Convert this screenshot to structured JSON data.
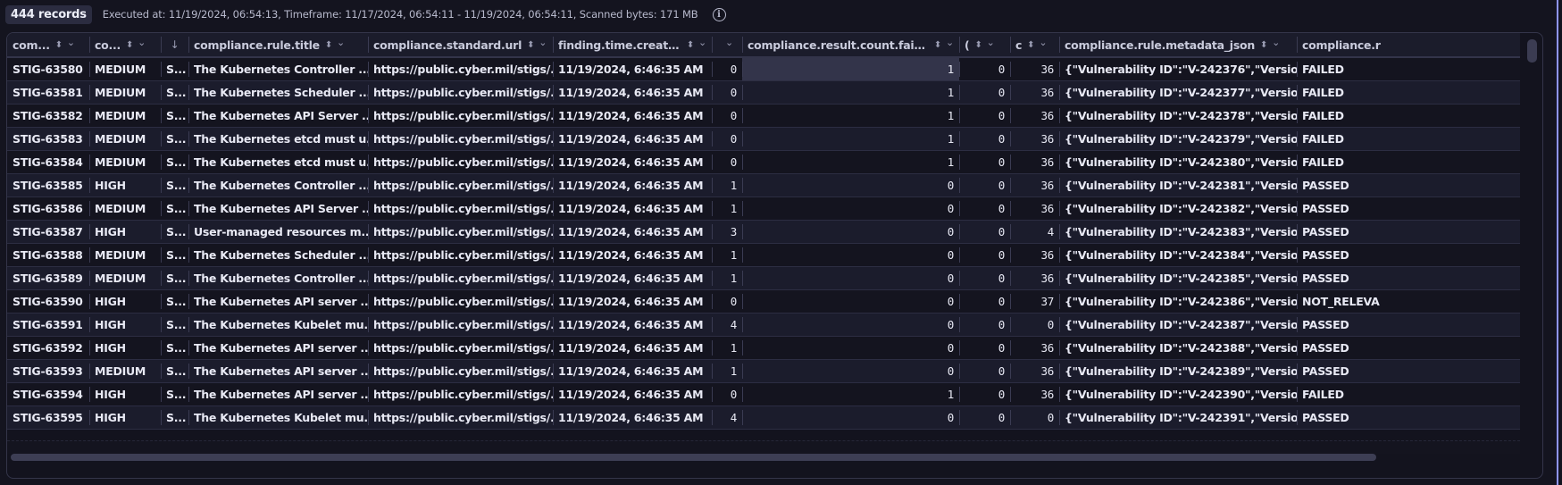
{
  "toolbar": {
    "record_count": "444 records",
    "execution_info": "Executed at: 11/19/2024, 06:54:13, Timeframe: 11/17/2024, 06:54:11 - 11/19/2024, 06:54:11, Scanned bytes: 171 MB",
    "info_icon": "info-icon"
  },
  "table": {
    "columns": [
      {
        "label": "com...",
        "sortable": true,
        "menu": true
      },
      {
        "label": "co...",
        "sortable": true,
        "menu": true
      },
      {
        "label": "",
        "sort_direction": "descending",
        "menu": false
      },
      {
        "label": "compliance.rule.title",
        "sortable": true,
        "menu": true
      },
      {
        "label": "compliance.standard.url",
        "sortable": true,
        "menu": true
      },
      {
        "label": "finding.time.created",
        "sortable": true,
        "menu": true
      },
      {
        "label": "",
        "sortable": false,
        "menu": true
      },
      {
        "label": "compliance.result.count.failed",
        "sortable": true,
        "menu": true
      },
      {
        "label": "(",
        "sortable": true,
        "menu": true
      },
      {
        "label": "c",
        "sortable": true,
        "menu": true
      },
      {
        "label": "compliance.rule.metadata_json",
        "sortable": true,
        "menu": true
      },
      {
        "label": "compliance.r",
        "sortable": false,
        "menu": false
      }
    ],
    "rows": [
      [
        "STIG-63580",
        "MEDIUM",
        "S...",
        "The Kubernetes Controller ...",
        "https://public.cyber.mil/stigs/...",
        "11/19/2024, 6:46:35 AM",
        "0",
        "1",
        "0",
        "36",
        "{\"Vulnerability ID\":\"V-242376\",\"Versio...",
        "FAILED"
      ],
      [
        "STIG-63581",
        "MEDIUM",
        "S...",
        "The Kubernetes Scheduler ...",
        "https://public.cyber.mil/stigs/...",
        "11/19/2024, 6:46:35 AM",
        "0",
        "1",
        "0",
        "36",
        "{\"Vulnerability ID\":\"V-242377\",\"Versio...",
        "FAILED"
      ],
      [
        "STIG-63582",
        "MEDIUM",
        "S...",
        "The Kubernetes API Server ...",
        "https://public.cyber.mil/stigs/...",
        "11/19/2024, 6:46:35 AM",
        "0",
        "1",
        "0",
        "36",
        "{\"Vulnerability ID\":\"V-242378\",\"Versio...",
        "FAILED"
      ],
      [
        "STIG-63583",
        "MEDIUM",
        "S...",
        "The Kubernetes etcd must u...",
        "https://public.cyber.mil/stigs/...",
        "11/19/2024, 6:46:35 AM",
        "0",
        "1",
        "0",
        "36",
        "{\"Vulnerability ID\":\"V-242379\",\"Versio...",
        "FAILED"
      ],
      [
        "STIG-63584",
        "MEDIUM",
        "S...",
        "The Kubernetes etcd must u...",
        "https://public.cyber.mil/stigs/...",
        "11/19/2024, 6:46:35 AM",
        "0",
        "1",
        "0",
        "36",
        "{\"Vulnerability ID\":\"V-242380\",\"Versio...",
        "FAILED"
      ],
      [
        "STIG-63585",
        "HIGH",
        "S...",
        "The Kubernetes Controller ...",
        "https://public.cyber.mil/stigs/...",
        "11/19/2024, 6:46:35 AM",
        "1",
        "0",
        "0",
        "36",
        "{\"Vulnerability ID\":\"V-242381\",\"Versio...",
        "PASSED"
      ],
      [
        "STIG-63586",
        "MEDIUM",
        "S...",
        "The Kubernetes API Server ...",
        "https://public.cyber.mil/stigs/...",
        "11/19/2024, 6:46:35 AM",
        "1",
        "0",
        "0",
        "36",
        "{\"Vulnerability ID\":\"V-242382\",\"Versio...",
        "PASSED"
      ],
      [
        "STIG-63587",
        "HIGH",
        "S...",
        "User-managed resources m...",
        "https://public.cyber.mil/stigs/...",
        "11/19/2024, 6:46:35 AM",
        "3",
        "0",
        "0",
        "4",
        "{\"Vulnerability ID\":\"V-242383\",\"Versio...",
        "PASSED"
      ],
      [
        "STIG-63588",
        "MEDIUM",
        "S...",
        "The Kubernetes Scheduler ...",
        "https://public.cyber.mil/stigs/...",
        "11/19/2024, 6:46:35 AM",
        "1",
        "0",
        "0",
        "36",
        "{\"Vulnerability ID\":\"V-242384\",\"Versio...",
        "PASSED"
      ],
      [
        "STIG-63589",
        "MEDIUM",
        "S...",
        "The Kubernetes Controller ...",
        "https://public.cyber.mil/stigs/...",
        "11/19/2024, 6:46:35 AM",
        "1",
        "0",
        "0",
        "36",
        "{\"Vulnerability ID\":\"V-242385\",\"Versio...",
        "PASSED"
      ],
      [
        "STIG-63590",
        "HIGH",
        "S...",
        "The Kubernetes API server ...",
        "https://public.cyber.mil/stigs/...",
        "11/19/2024, 6:46:35 AM",
        "0",
        "0",
        "0",
        "37",
        "{\"Vulnerability ID\":\"V-242386\",\"Versio...",
        "NOT_RELEVA"
      ],
      [
        "STIG-63591",
        "HIGH",
        "S...",
        "The Kubernetes Kubelet mu...",
        "https://public.cyber.mil/stigs/...",
        "11/19/2024, 6:46:35 AM",
        "4",
        "0",
        "0",
        "0",
        "{\"Vulnerability ID\":\"V-242387\",\"Versio...",
        "PASSED"
      ],
      [
        "STIG-63592",
        "HIGH",
        "S...",
        "The Kubernetes API server ...",
        "https://public.cyber.mil/stigs/...",
        "11/19/2024, 6:46:35 AM",
        "1",
        "0",
        "0",
        "36",
        "{\"Vulnerability ID\":\"V-242388\",\"Versio...",
        "PASSED"
      ],
      [
        "STIG-63593",
        "MEDIUM",
        "S...",
        "The Kubernetes API server ...",
        "https://public.cyber.mil/stigs/...",
        "11/19/2024, 6:46:35 AM",
        "1",
        "0",
        "0",
        "36",
        "{\"Vulnerability ID\":\"V-242389\",\"Versio...",
        "PASSED"
      ],
      [
        "STIG-63594",
        "HIGH",
        "S...",
        "The Kubernetes API server ...",
        "https://public.cyber.mil/stigs/...",
        "11/19/2024, 6:46:35 AM",
        "0",
        "1",
        "0",
        "36",
        "{\"Vulnerability ID\":\"V-242390\",\"Versio...",
        "FAILED"
      ],
      [
        "STIG-63595",
        "HIGH",
        "S...",
        "The Kubernetes Kubelet mu...",
        "https://public.cyber.mil/stigs/...",
        "11/19/2024, 6:46:35 AM",
        "4",
        "0",
        "0",
        "0",
        "{\"Vulnerability ID\":\"V-242391\",\"Versio...",
        "PASSED"
      ]
    ],
    "highlighted_cell": {
      "row": 0,
      "column": 7
    }
  },
  "colors": {
    "background": "#14141f",
    "accent_line": "#8f95ff",
    "row_alt": "#1b1c2c",
    "highlight": "#33344a"
  }
}
